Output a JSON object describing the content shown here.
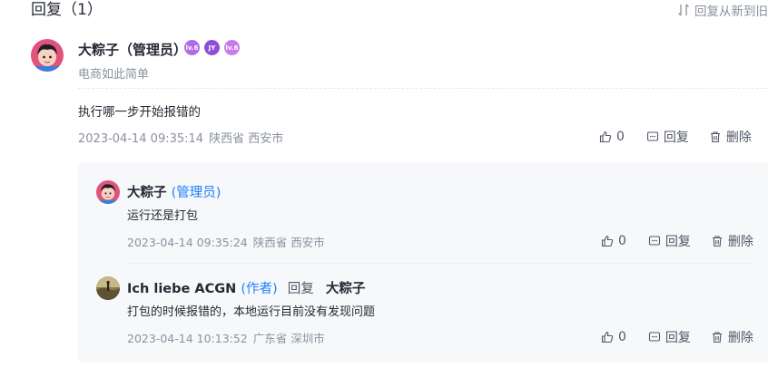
{
  "header": {
    "title": "回复（1）",
    "sort_label": "回复从新到旧"
  },
  "comment": {
    "author": "大粽子（管理员）",
    "badges": [
      "lv.6",
      "JY",
      "lv.6"
    ],
    "subtitle": "电商如此简单",
    "content": "执行哪一步开始报错的",
    "time": "2023-04-14 09:35:14",
    "location": "陕西省 西安市",
    "likes": "0",
    "reply_label": "回复",
    "delete_label": "删除"
  },
  "replies": [
    {
      "author": "大粽子",
      "role": "(管理员)",
      "content": "运行还是打包",
      "time": "2023-04-14 09:35:24",
      "location": "陕西省 西安市",
      "likes": "0",
      "reply_label": "回复",
      "delete_label": "删除"
    },
    {
      "author": "Ich liebe ACGN",
      "role": "(作者)",
      "reply_word": "回复",
      "reply_target": "大粽子",
      "content": "打包的时候报错的，本地运行目前没有发现问题",
      "time": "2023-04-14 10:13:52",
      "location": "广东省 深圳市",
      "likes": "0",
      "reply_label": "回复",
      "delete_label": "删除"
    }
  ],
  "colors": {
    "accent": "#1e80ff",
    "muted": "#8a919f",
    "reply_bg": "#f7f8fa",
    "badge_purple": "#b36ae6"
  },
  "icons": [
    "sort-icon",
    "thumbs-up-icon",
    "comment-icon",
    "trash-icon",
    "avatar"
  ]
}
